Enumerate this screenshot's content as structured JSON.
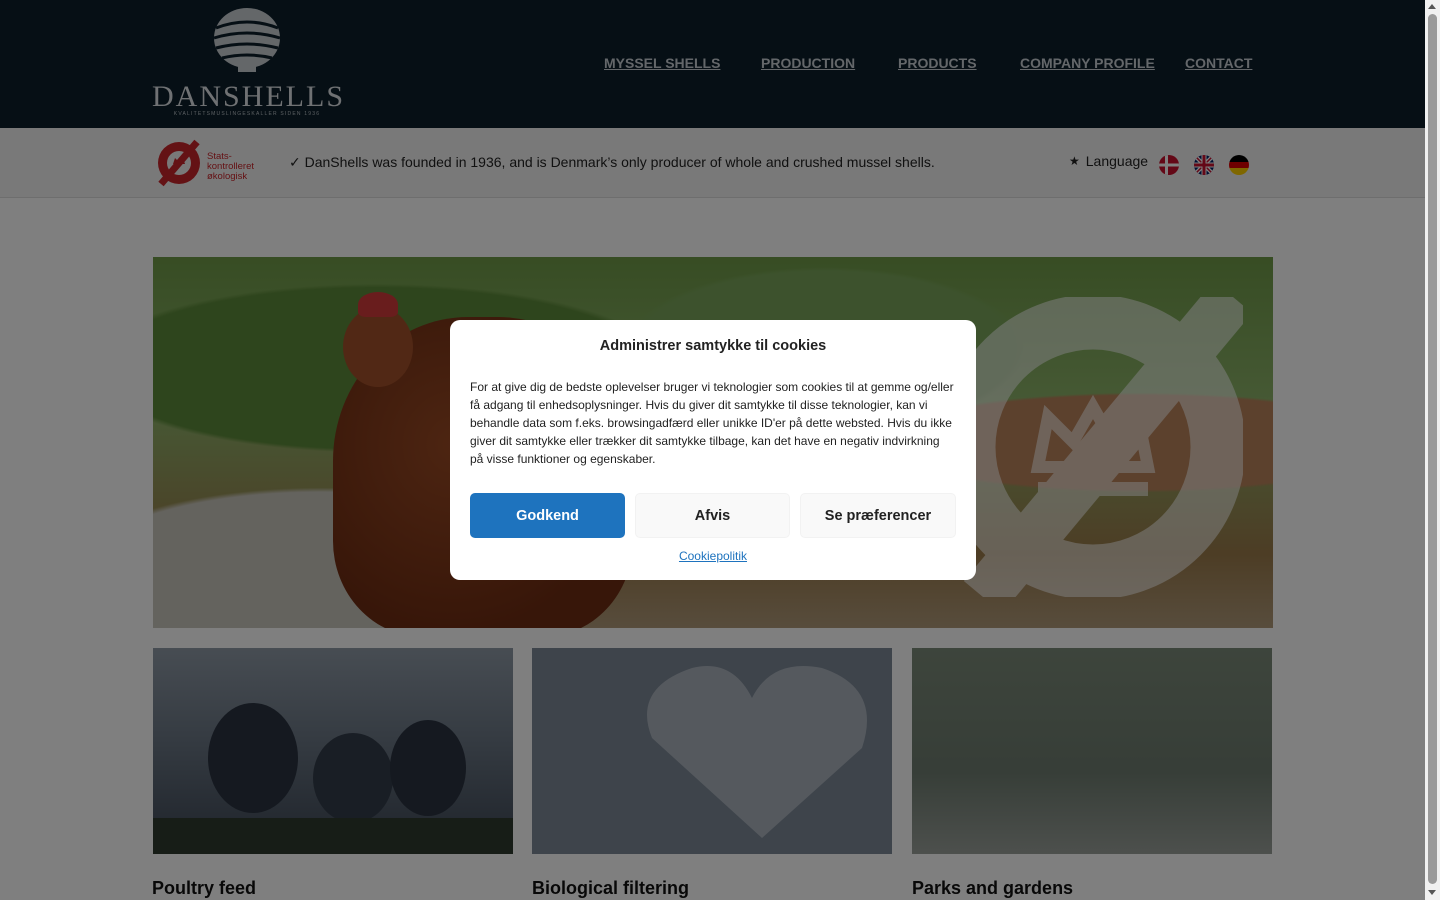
{
  "brand": {
    "name": "DANSHELLS",
    "tagline": "KVALITETSMUSLINGESKALLER SIDEN 1936"
  },
  "nav": {
    "items": [
      {
        "label": "MYSSEL SHELLS"
      },
      {
        "label": "PRODUCTION"
      },
      {
        "label": "PRODUCTS"
      },
      {
        "label": "COMPANY PROFILE"
      },
      {
        "label": "CONTACT"
      }
    ]
  },
  "infobar": {
    "eco_label": [
      "Stats-",
      "kontrolleret",
      "økologisk"
    ],
    "founded_text": "✓ DanShells was founded in 1936, and is Denmark’s only producer of whole and crushed mussel shells.",
    "language_label": "Language",
    "flags": [
      "danish-flag-icon",
      "uk-flag-icon",
      "german-flag-icon"
    ]
  },
  "cards": [
    {
      "title": "Poultry feed"
    },
    {
      "title": "Biological filtering"
    },
    {
      "title": "Parks and gardens"
    }
  ],
  "cookie_modal": {
    "title": "Administrer samtykke til cookies",
    "body": "For at give dig de bedste oplevelser bruger vi teknologier som cookies til at gemme og/eller få adgang til enhedsoplysninger. Hvis du giver dit samtykke til disse teknologier, kan vi behandle data som f.eks. browsingadfærd eller unikke ID'er på dette websted. Hvis du ikke giver dit samtykke eller trækker dit samtykke tilbage, kan det have en negativ indvirkning på visse funktioner og egenskaber.",
    "accept_label": "Godkend",
    "deny_label": "Afvis",
    "preferences_label": "Se præferencer",
    "policy_link": "Cookiepolitik"
  },
  "colors": {
    "header_bg": "#0d1f2b",
    "accent": "#1e73be",
    "eco_red": "#c9242a"
  }
}
